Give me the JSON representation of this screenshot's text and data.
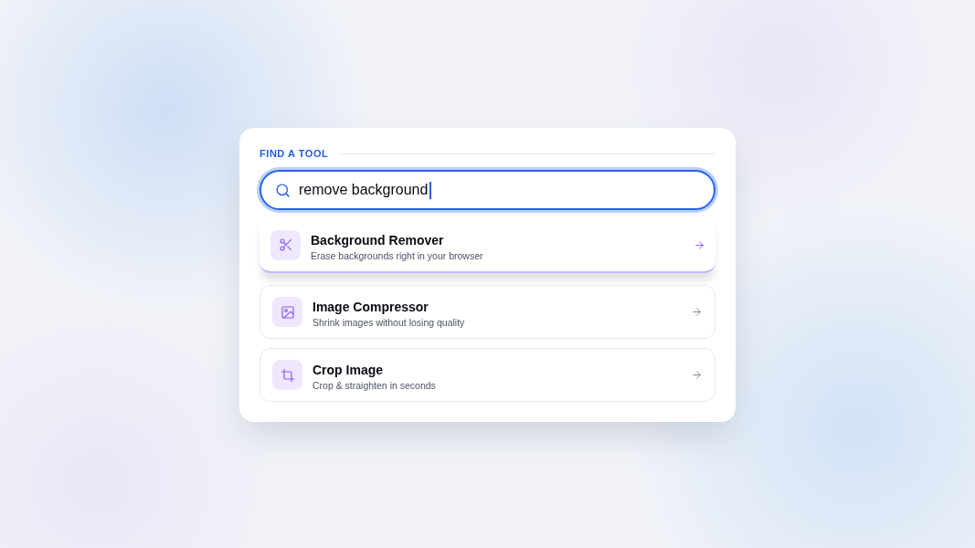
{
  "section_label": "FIND A TOOL",
  "search": {
    "value": "remove background",
    "focused": true
  },
  "results": [
    {
      "title": "Background Remover",
      "subtitle": "Erase backgrounds right in your browser",
      "selected": true
    },
    {
      "title": "Image Compressor",
      "subtitle": "Shrink images without losing quality",
      "selected": false
    },
    {
      "title": "Crop Image",
      "subtitle": "Crop & straighten in seconds",
      "selected": false
    }
  ]
}
